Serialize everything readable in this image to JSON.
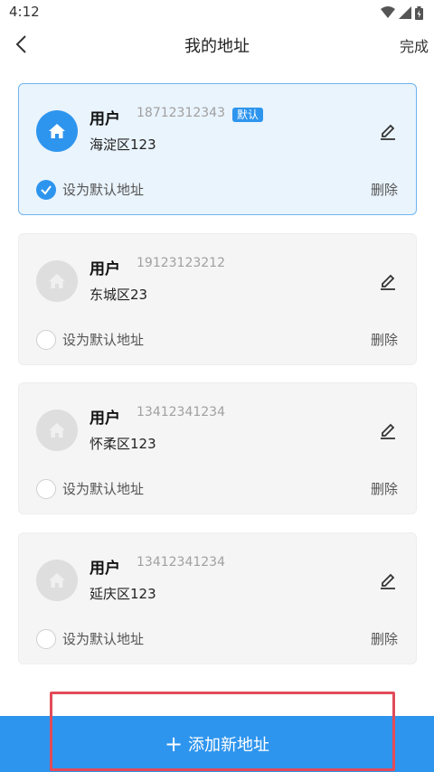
{
  "status_bar": {
    "time": "4:12"
  },
  "header": {
    "title": "我的地址",
    "done_label": "完成"
  },
  "addresses": [
    {
      "name": "用户",
      "phone": "18712312343",
      "badge": "默认",
      "address": "海淀区123",
      "default_label": "设为默认地址",
      "delete_label": "删除",
      "is_default": true
    },
    {
      "name": "用户",
      "phone": "19123123212",
      "address": "东城区23",
      "default_label": "设为默认地址",
      "delete_label": "删除",
      "is_default": false
    },
    {
      "name": "用户",
      "phone": "13412341234",
      "address": "怀柔区123",
      "default_label": "设为默认地址",
      "delete_label": "删除",
      "is_default": false
    },
    {
      "name": "用户",
      "phone": "13412341234",
      "address": "延庆区123",
      "default_label": "设为默认地址",
      "delete_label": "删除",
      "is_default": false
    }
  ],
  "footer": {
    "add_icon": "+",
    "add_label": "添加新地址"
  },
  "colors": {
    "accent": "#2e95ee",
    "highlight": "#e24b59"
  }
}
